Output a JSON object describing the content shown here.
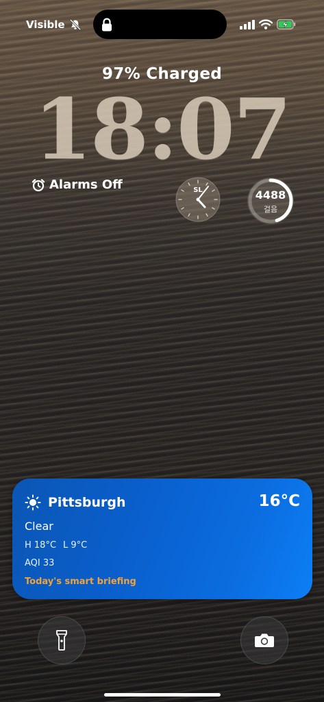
{
  "status_bar": {
    "carrier": "Visible"
  },
  "lockscreen": {
    "charge_status": "97% Charged",
    "time": "18:07",
    "alarm": "Alarms Off",
    "clock_widget_city": "SL",
    "steps": {
      "value": "4488",
      "unit": "걸음",
      "progress": 0.45
    }
  },
  "weather": {
    "city": "Pittsburgh",
    "temperature": "16°C",
    "condition": "Clear",
    "high": "H 18°C",
    "low": "L 9°C",
    "aqi": "AQI 33",
    "briefing": "Today's smart briefing"
  },
  "colors": {
    "briefing": "#f0a33a",
    "weather_card": "#0b6de0"
  },
  "icons": [
    "bell-off-icon",
    "lock-icon",
    "signal-icon",
    "wifi-icon",
    "battery-charging-icon",
    "alarm-clock-icon",
    "sun-icon",
    "flashlight-icon",
    "camera-icon"
  ]
}
